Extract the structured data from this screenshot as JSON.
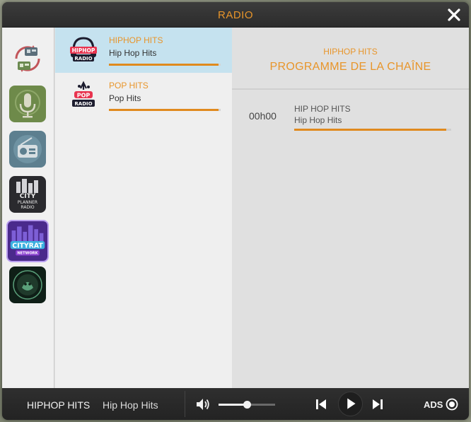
{
  "window": {
    "title": "RADIO",
    "close_icon": "close-icon"
  },
  "categories": [
    {
      "icon": "radio-switch-icon",
      "label": ""
    },
    {
      "icon": "microphone-icon",
      "label": ""
    },
    {
      "icon": "radio-device-icon",
      "label": ""
    },
    {
      "icon": "city-planner-radio-icon",
      "label": "CITY PLANNER RADIO"
    },
    {
      "icon": "cityrat-network-icon",
      "label": "CITYRAT NETWORK"
    },
    {
      "icon": "dark-emblem-icon",
      "label": ""
    }
  ],
  "stations": [
    {
      "name": "HIPHOP HITS",
      "subtitle": "Hip Hop Hits",
      "logo_text_top": "HIPHOP",
      "logo_text_bottom": "RADIO",
      "progress": 0.98,
      "selected": true
    },
    {
      "name": "POP HITS",
      "subtitle": "Pop Hits",
      "logo_text_top": "POP",
      "logo_text_bottom": "RADIO",
      "progress": 0.98,
      "selected": false
    }
  ],
  "program": {
    "station_name": "HIPHOP HITS",
    "heading": "PROGRAMME DE LA CHAÎNE",
    "entries": [
      {
        "time": "00h00",
        "title": "HIP HOP HITS",
        "subtitle": "Hip Hop Hits",
        "progress": 0.97
      }
    ]
  },
  "player": {
    "now_playing_name": "HIPHOP HITS",
    "now_playing_subtitle": "Hip Hop Hits",
    "volume": 0.5,
    "ads_label": "ADS"
  },
  "colors": {
    "accent": "#e8952a",
    "selected_row": "#c5e2ef",
    "player_bg": "#262626"
  }
}
